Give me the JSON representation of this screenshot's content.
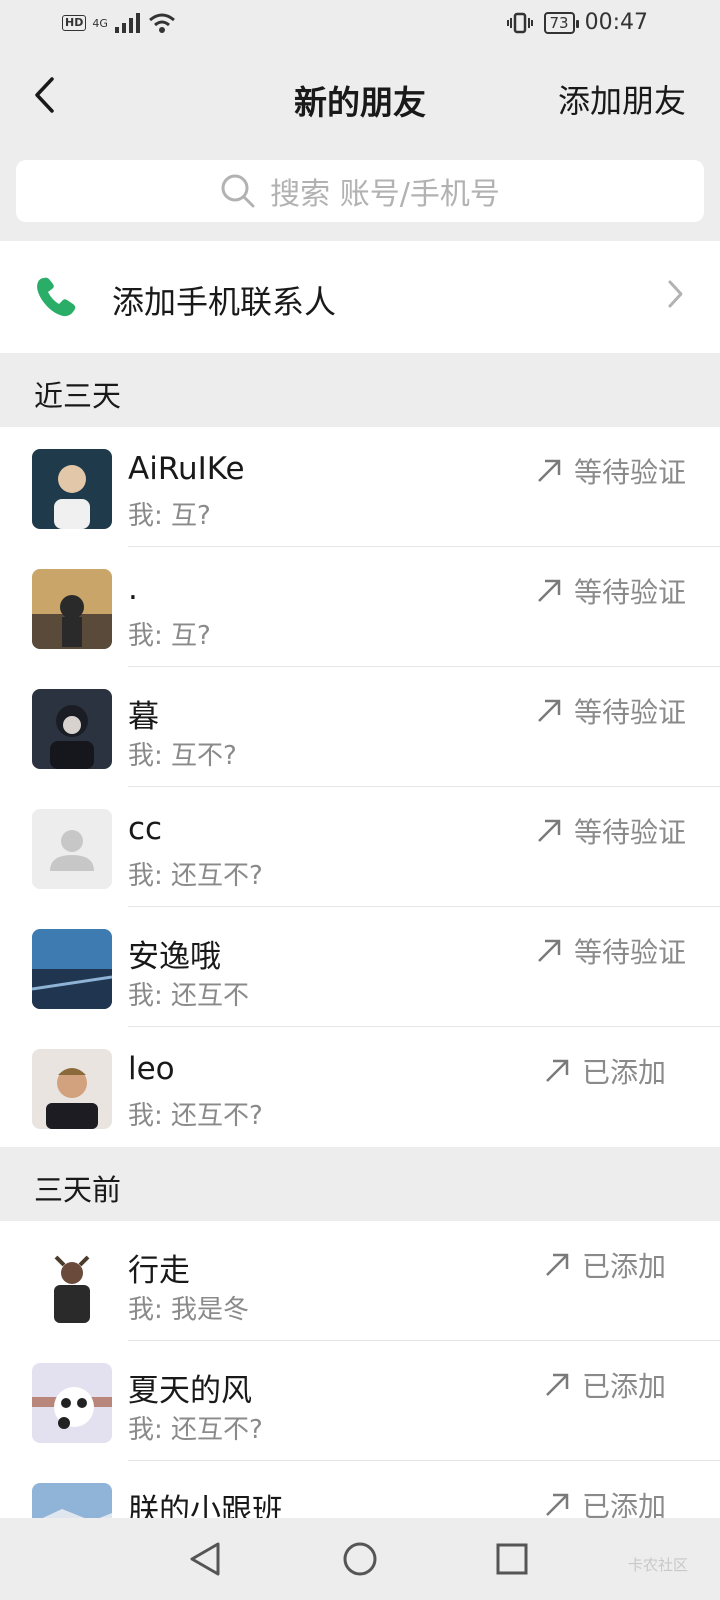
{
  "status_bar": {
    "hd": "HD",
    "network_top": "4G",
    "network_bottom": "↕",
    "battery": "73",
    "time": "00:47"
  },
  "header": {
    "title": "新的朋友",
    "action": "添加朋友"
  },
  "search": {
    "placeholder": "搜索 账号/手机号"
  },
  "add_phone_contacts": {
    "label": "添加手机联系人"
  },
  "sections": [
    {
      "title": "近三天",
      "items": [
        {
          "name": "AiRuIKe",
          "message": "我: 互?",
          "status": "等待验证"
        },
        {
          "name": ".",
          "message": "我: 互?",
          "status": "等待验证"
        },
        {
          "name": "暮",
          "message": "我: 互不?",
          "status": "等待验证"
        },
        {
          "name": "cc",
          "message": "我: 还互不?",
          "status": "等待验证"
        },
        {
          "name": "安逸哦",
          "message": "我: 还互不",
          "status": "等待验证"
        },
        {
          "name": "leo",
          "message": "我: 还互不?",
          "status": "已添加"
        }
      ]
    },
    {
      "title": "三天前",
      "items": [
        {
          "name": "行走",
          "message": "我: 我是冬",
          "status": "已添加"
        },
        {
          "name": "夏天的风",
          "message": "我: 还互不?",
          "status": "已添加"
        },
        {
          "name": "朕的小跟班",
          "message": "",
          "status": "已添加"
        }
      ]
    }
  ],
  "watermark": "卡农社区",
  "colors": {
    "background": "#ededed",
    "phone_icon": "#2aae67",
    "secondary_text": "#8a8a8a"
  }
}
